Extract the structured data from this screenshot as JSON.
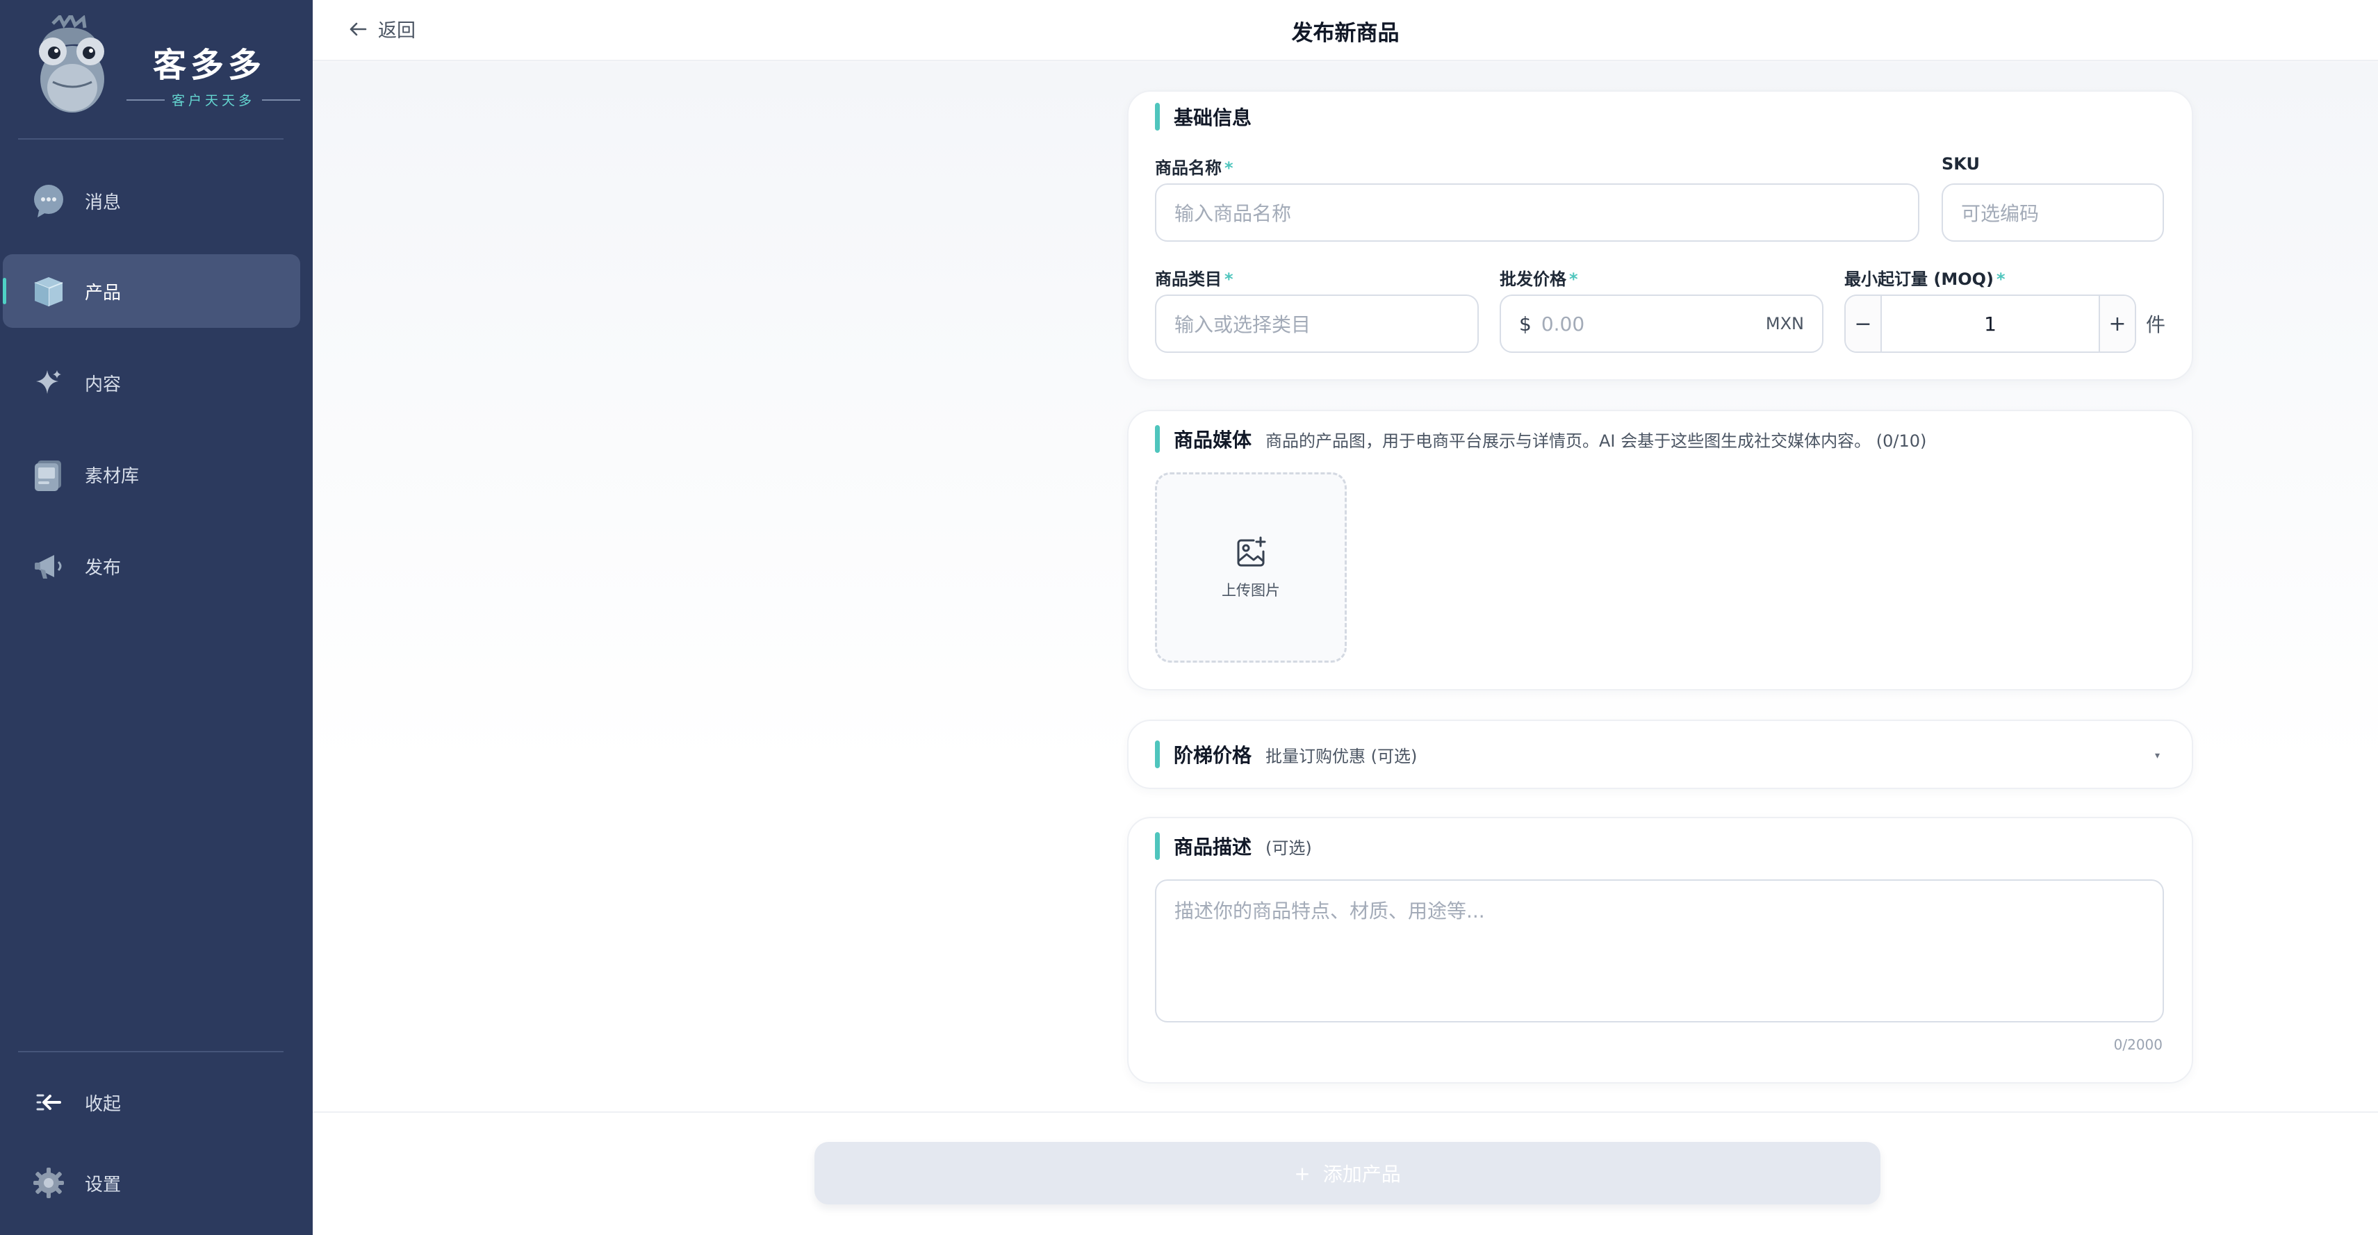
{
  "sidebar": {
    "brand": {
      "name": "客多多",
      "slogan": "客户天天多"
    },
    "items": [
      {
        "label": "消息",
        "icon": "chat-bubble-icon"
      },
      {
        "label": "产品",
        "icon": "box-icon",
        "active": true
      },
      {
        "label": "内容",
        "icon": "sparkle-icon"
      },
      {
        "label": "素材库",
        "icon": "gallery-icon"
      },
      {
        "label": "发布",
        "icon": "megaphone-icon"
      }
    ],
    "bottom": [
      {
        "label": "收起",
        "icon": "collapse-arrow-icon"
      },
      {
        "label": "设置",
        "icon": "gear-icon"
      }
    ]
  },
  "header": {
    "back_label": "返回",
    "title": "发布新商品"
  },
  "basic": {
    "title": "基础信息",
    "required_mark": "*",
    "name": {
      "label": "商品名称",
      "placeholder": "输入商品名称"
    },
    "sku": {
      "label": "SKU",
      "placeholder": "可选编码"
    },
    "category": {
      "label": "商品类目",
      "placeholder": "输入或选择类目"
    },
    "price": {
      "label": "批发价格",
      "prefix": "$",
      "placeholder": "0.00",
      "currency": "MXN"
    },
    "moq": {
      "label": "最小起订量 (MOQ)",
      "minus": "−",
      "value": "1",
      "plus": "+",
      "unit": "件"
    }
  },
  "media": {
    "title": "商品媒体",
    "hint": "商品的产品图，用于电商平台展示与详情页。AI 会基于这些图生成社交媒体内容。 (0/10)",
    "upload_label": "上传图片"
  },
  "tier": {
    "title": "阶梯价格",
    "subtitle": "批量订购优惠 (可选)",
    "chevron": "▾"
  },
  "description": {
    "title": "商品描述",
    "subtitle": "(可选)",
    "placeholder": "描述你的商品特点、材质、用途等...",
    "counter": "0/2000"
  },
  "submit": {
    "icon": "+",
    "label": "添加产品"
  },
  "colors": {
    "sidebar": "#2c3a5e",
    "accent": "#4fc5bd",
    "active_item": "#46557a"
  }
}
